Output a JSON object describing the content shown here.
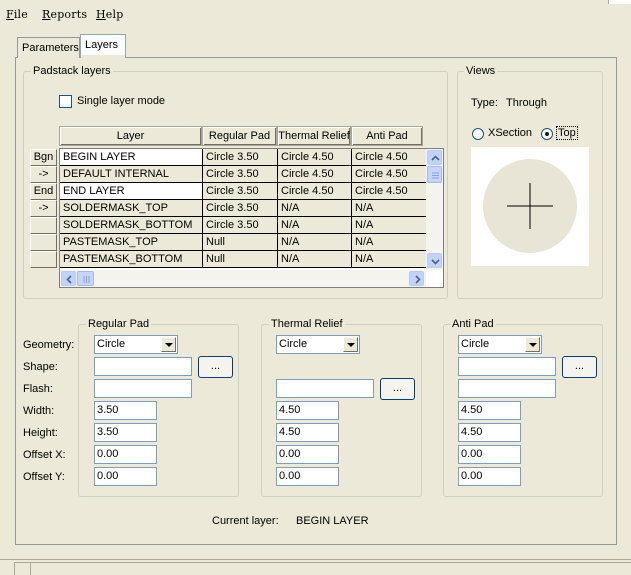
{
  "menu": {
    "file": "File",
    "reports": "Reports",
    "help": "Help"
  },
  "tabs": [
    {
      "label": "Parameters"
    },
    {
      "label": "Layers",
      "active": true
    }
  ],
  "padstack": {
    "group_label": "Padstack layers",
    "single_layer_mode_label": "Single layer mode",
    "single_layer_mode_checked": false,
    "columns": [
      "Layer",
      "Regular Pad",
      "Thermal Relief",
      "Anti Pad"
    ],
    "row_buttons": [
      "Bgn",
      "->",
      "End",
      "->",
      "",
      "",
      ""
    ],
    "rows": [
      {
        "layer": "BEGIN LAYER",
        "regular": "Circle 3.50",
        "thermal": "Circle 4.50",
        "anti": "Circle 4.50"
      },
      {
        "layer": "DEFAULT INTERNAL",
        "regular": "Circle 3.50",
        "thermal": "Circle 4.50",
        "anti": "Circle 4.50"
      },
      {
        "layer": "END LAYER",
        "regular": "Circle 3.50",
        "thermal": "Circle 4.50",
        "anti": "Circle 4.50"
      },
      {
        "layer": "SOLDERMASK_TOP",
        "regular": "Circle 3.50",
        "thermal": "N/A",
        "anti": "N/A"
      },
      {
        "layer": "SOLDERMASK_BOTTOM",
        "regular": "Circle 3.50",
        "thermal": "N/A",
        "anti": "N/A"
      },
      {
        "layer": "PASTEMASK_TOP",
        "regular": "Null",
        "thermal": "N/A",
        "anti": "N/A"
      },
      {
        "layer": "PASTEMASK_BOTTOM",
        "regular": "Null",
        "thermal": "N/A",
        "anti": "N/A"
      }
    ]
  },
  "views": {
    "group_label": "Views",
    "type_label": "Type:",
    "type_value": "Through",
    "xsection_label": "XSection",
    "top_label": "Top",
    "selected": "Top"
  },
  "form": {
    "labels": {
      "geometry": "Geometry:",
      "shape": "Shape:",
      "flash": "Flash:",
      "width": "Width:",
      "height": "Height:",
      "offset_x": "Offset X:",
      "offset_y": "Offset Y:"
    },
    "browse_label": "...",
    "regular_pad": {
      "title": "Regular Pad",
      "geometry": "Circle",
      "shape": "",
      "flash": "",
      "width": "3.50",
      "height": "3.50",
      "offset_x": "0.00",
      "offset_y": "0.00"
    },
    "thermal_relief": {
      "title": "Thermal Relief",
      "geometry": "Circle",
      "flash": "",
      "width": "4.50",
      "height": "4.50",
      "offset_x": "0.00",
      "offset_y": "0.00"
    },
    "anti_pad": {
      "title": "Anti Pad",
      "geometry": "Circle",
      "shape": "",
      "flash": "",
      "width": "4.50",
      "height": "4.50",
      "offset_x": "0.00",
      "offset_y": "0.00"
    }
  },
  "current_layer": {
    "label": "Current layer:",
    "value": "BEGIN LAYER"
  },
  "colors": {
    "window_bg": "#ece9d8",
    "selected_row": "#ffffff",
    "grid_lines": "#000000",
    "input_border": "#7f9db9",
    "pad_preview": "#e8e4d6"
  }
}
